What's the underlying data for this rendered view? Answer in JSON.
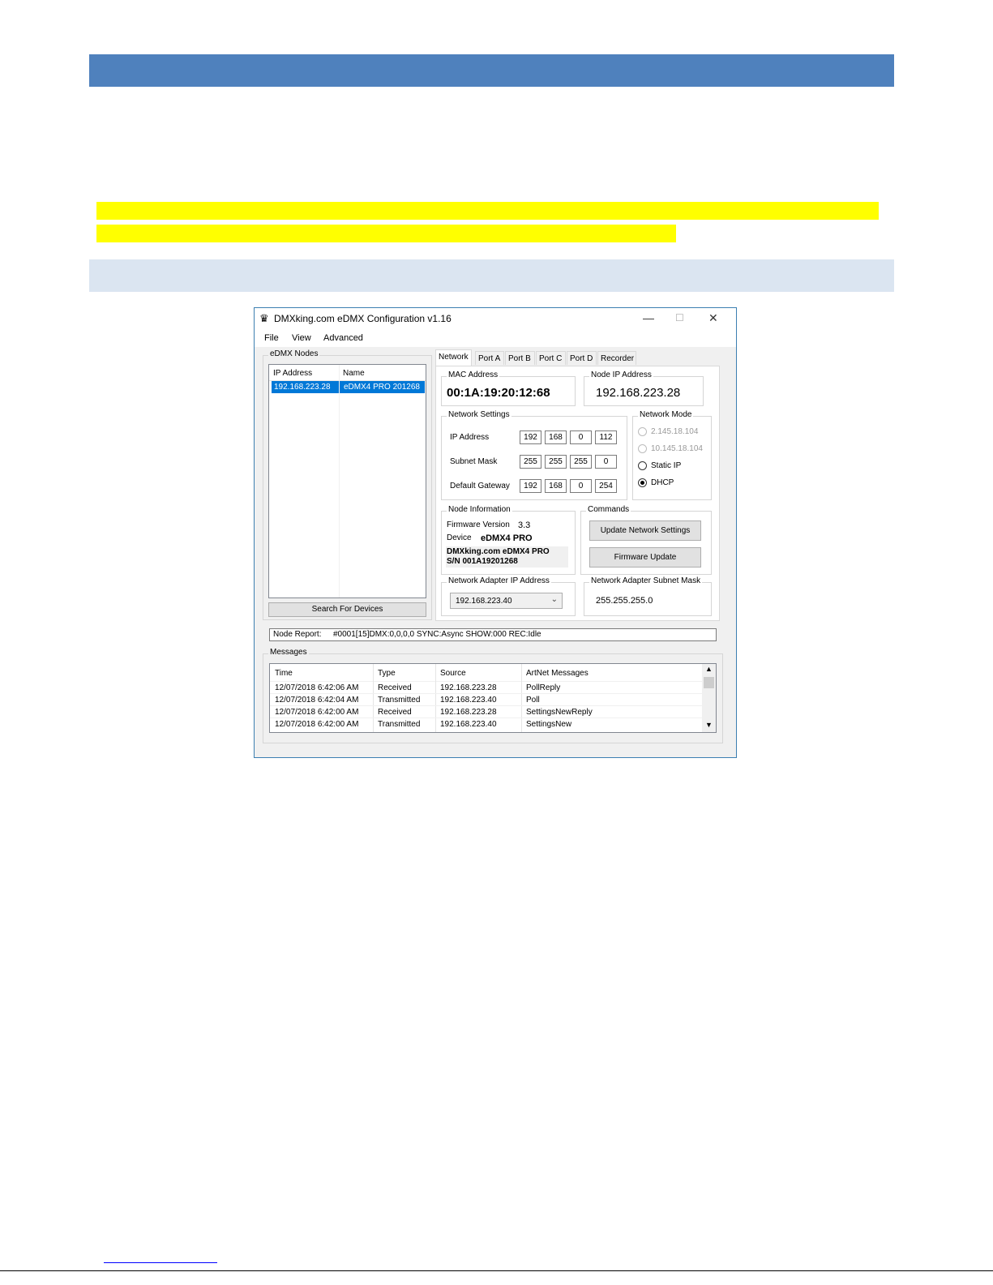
{
  "window": {
    "title": "DMXking.com eDMX Configuration v1.16",
    "minimize": "—",
    "maximize": "☐",
    "close": "✕"
  },
  "menu": {
    "file": "File",
    "view": "View",
    "advanced": "Advanced"
  },
  "nodes_panel": {
    "label": "eDMX Nodes",
    "columns": [
      "IP Address",
      "Name"
    ],
    "rows": [
      {
        "ip": "192.168.223.28",
        "name": "eDMX4 PRO 201268"
      }
    ],
    "search_button": "Search For Devices"
  },
  "tabs": [
    "Network",
    "Port A",
    "Port B",
    "Port C",
    "Port D",
    "Recorder"
  ],
  "network": {
    "mac_label": "MAC Address",
    "mac_value": "00:1A:19:20:12:68",
    "node_ip_label": "Node IP Address",
    "node_ip_value": "192.168.223.28",
    "settings_label": "Network Settings",
    "ip_label": "IP Address",
    "ip": [
      "192",
      "168",
      "0",
      "112"
    ],
    "subnet_label": "Subnet Mask",
    "subnet": [
      "255",
      "255",
      "255",
      "0"
    ],
    "gateway_label": "Default Gateway",
    "gateway": [
      "192",
      "168",
      "0",
      "254"
    ],
    "mode_label": "Network Mode",
    "modes": [
      "2.145.18.104",
      "10.145.18.104",
      "Static IP",
      "DHCP"
    ],
    "selected_mode": "DHCP",
    "node_info_label": "Node Information",
    "firmware_label": "Firmware Version",
    "firmware_value": "3.3",
    "device_label": "Device",
    "device_value": "eDMX4 PRO",
    "info_line1": "DMXking.com eDMX4 PRO",
    "info_line2": "S/N 001A19201268",
    "commands_label": "Commands",
    "update_button": "Update Network Settings",
    "firmware_button": "Firmware Update",
    "adapter_ip_label": "Network Adapter IP Address",
    "adapter_ip_value": "192.168.223.40",
    "adapter_mask_label": "Network Adapter Subnet Mask",
    "adapter_mask_value": "255.255.255.0"
  },
  "node_report": {
    "label": "Node Report:",
    "value": "#0001[15]DMX:0,0,0,0 SYNC:Async SHOW:000 REC:Idle"
  },
  "messages": {
    "label": "Messages",
    "columns": [
      "Time",
      "Type",
      "Source",
      "ArtNet Messages"
    ],
    "rows": [
      {
        "time": "12/07/2018 6:42:06 AM",
        "type": "Received",
        "source": "192.168.223.28",
        "msg": "PollReply"
      },
      {
        "time": "12/07/2018 6:42:04 AM",
        "type": "Transmitted",
        "source": "192.168.223.40",
        "msg": "Poll"
      },
      {
        "time": "12/07/2018 6:42:00 AM",
        "type": "Received",
        "source": "192.168.223.28",
        "msg": "SettingsNewReply"
      },
      {
        "time": "12/07/2018 6:42:00 AM",
        "type": "Transmitted",
        "source": "192.168.223.40",
        "msg": "SettingsNew"
      }
    ]
  },
  "colors": {
    "heading_bar": "#4f81bd",
    "highlight": "#ffff00",
    "subheading_bar": "#dbe5f1",
    "selection": "#0078d7"
  }
}
